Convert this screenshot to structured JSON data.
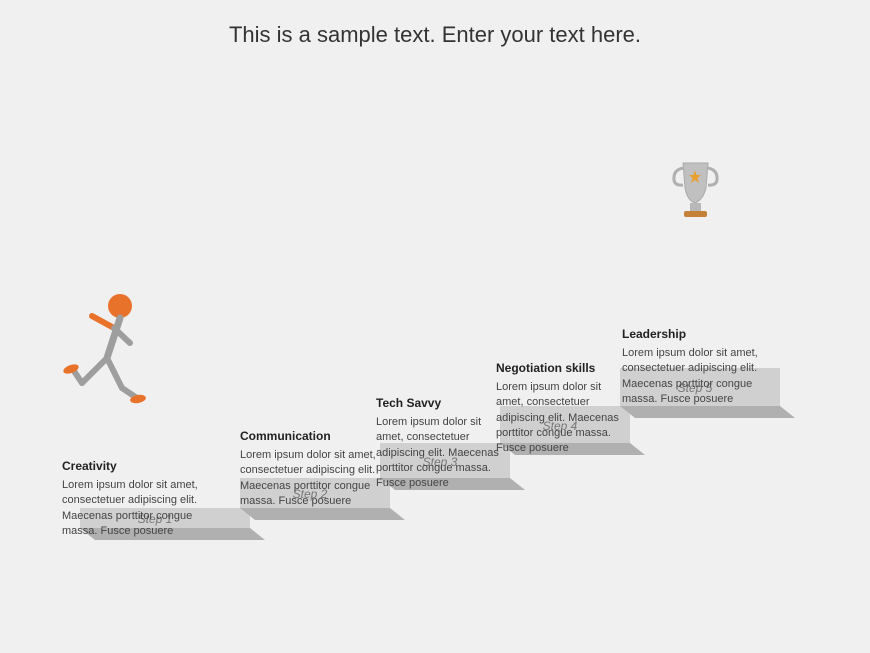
{
  "title": "This is a sample text. Enter your text here.",
  "steps": [
    {
      "id": "step1",
      "label": "Step 1",
      "heading": "Creativity",
      "body": "Lorem ipsum dolor sit amet, consectetuer adipiscing elit. Maecenas porttitor congue massa. Fusce posuere"
    },
    {
      "id": "step2",
      "label": "Step 2",
      "heading": "Communication",
      "body": "Lorem ipsum dolor sit amet, consectetuer adipiscing elit. Maecenas porttitor congue massa. Fusce posuere"
    },
    {
      "id": "step3",
      "label": "Step 3",
      "heading": "Tech Savvy",
      "body": "Lorem ipsum dolor sit amet, consectetuer adipiscing elit. Maecenas porttitor congue massa. Fusce posuere"
    },
    {
      "id": "step4",
      "label": "Step 4",
      "heading": "Negotiation skills",
      "body": "Lorem ipsum dolor sit amet, consectetuer adipiscing elit. Maecenas porttitor congue massa. Fusce posuere"
    },
    {
      "id": "step5",
      "label": "Step 5",
      "heading": "Leadership",
      "body": "Lorem ipsum dolor sit amet, consectetuer adipiscing elit. Maecenas porttitor congue massa. Fusce posuere"
    }
  ],
  "colors": {
    "step_fill": "#d4d4d4",
    "step_shadow": "#aaaaaa",
    "orange": "#e8722a",
    "text_dark": "#333333",
    "text_light": "#777777"
  }
}
